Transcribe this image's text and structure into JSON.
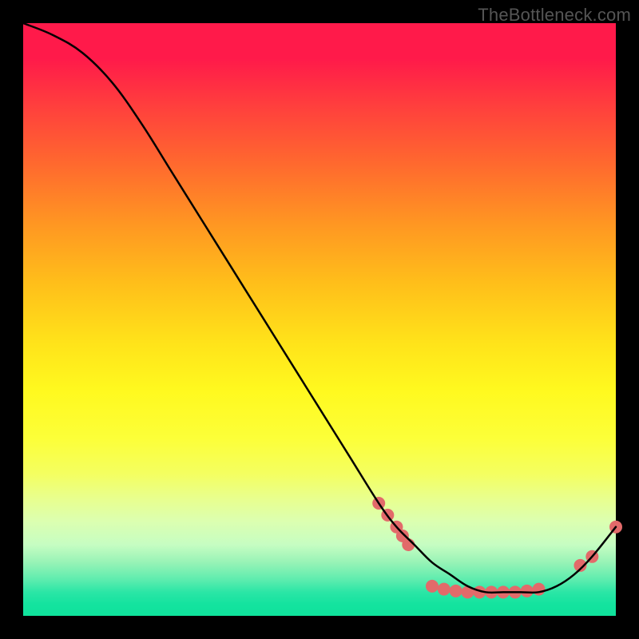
{
  "watermark": "TheBottleneck.com",
  "chart_data": {
    "type": "line",
    "title": "",
    "xlabel": "",
    "ylabel": "",
    "xlim": [
      0,
      100
    ],
    "ylim": [
      0,
      100
    ],
    "grid": false,
    "legend": false,
    "series": [
      {
        "name": "curve",
        "x": [
          0,
          5,
          10,
          15,
          20,
          25,
          30,
          35,
          40,
          45,
          50,
          55,
          60,
          63,
          66,
          69,
          72,
          75,
          78,
          81,
          84,
          87,
          90,
          93,
          96,
          100
        ],
        "y": [
          100,
          98,
          95,
          90,
          83,
          75,
          67,
          59,
          51,
          43,
          35,
          27,
          19,
          15,
          12,
          9,
          7,
          5,
          4,
          4,
          4,
          4,
          5,
          7,
          10,
          15
        ]
      }
    ],
    "markers": [
      {
        "x": 60.0,
        "y": 19.0
      },
      {
        "x": 61.5,
        "y": 17.0
      },
      {
        "x": 63.0,
        "y": 15.0
      },
      {
        "x": 64.0,
        "y": 13.5
      },
      {
        "x": 65.0,
        "y": 12.0
      },
      {
        "x": 69.0,
        "y": 5.0
      },
      {
        "x": 71.0,
        "y": 4.5
      },
      {
        "x": 73.0,
        "y": 4.2
      },
      {
        "x": 75.0,
        "y": 4.0
      },
      {
        "x": 77.0,
        "y": 4.0
      },
      {
        "x": 79.0,
        "y": 4.0
      },
      {
        "x": 81.0,
        "y": 4.0
      },
      {
        "x": 83.0,
        "y": 4.0
      },
      {
        "x": 85.0,
        "y": 4.2
      },
      {
        "x": 87.0,
        "y": 4.5
      },
      {
        "x": 94.0,
        "y": 8.5
      },
      {
        "x": 96.0,
        "y": 10.0
      },
      {
        "x": 100.0,
        "y": 15.0
      }
    ],
    "marker_color": "#e26a6a",
    "line_color": "#000000"
  }
}
